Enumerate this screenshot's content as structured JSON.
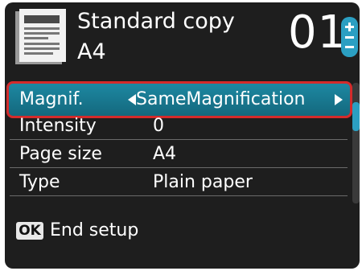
{
  "header": {
    "mode_title": "Standard copy",
    "paper_size": "A4",
    "copies": "01"
  },
  "settings": {
    "items": [
      {
        "label": "Magnif.",
        "value": "SameMagnification",
        "selected": true
      },
      {
        "label": "Intensity",
        "value": "0"
      },
      {
        "label": "Page size",
        "value": "A4"
      },
      {
        "label": "Type",
        "value": "Plain paper"
      }
    ]
  },
  "footer": {
    "key_label": "OK",
    "text": "End setup"
  },
  "colors": {
    "selected_row": "#1d88a2",
    "highlight_border": "#d42b2b",
    "background": "#1e1e1e",
    "accent": "#2b9fc2"
  },
  "icons": [
    "document-thumbnail-icon",
    "plus-minus-stepper-icon",
    "arrow-left-icon",
    "arrow-right-icon"
  ]
}
